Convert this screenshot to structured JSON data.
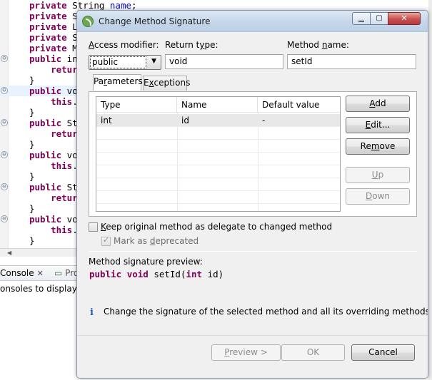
{
  "editor": {
    "lines": [
      {
        "kw": "private",
        "rest": " String ",
        "field": "name",
        "tail": ";",
        "fold": false,
        "highlight": false
      },
      {
        "kw": "private",
        "rest": " S",
        "field": "",
        "tail": "",
        "fold": false,
        "highlight": false
      },
      {
        "kw": "private",
        "rest": " L",
        "field": "",
        "tail": "",
        "fold": false,
        "highlight": false
      },
      {
        "kw": "private",
        "rest": " S",
        "field": "",
        "tail": "",
        "fold": false,
        "highlight": false
      },
      {
        "kw": "private",
        "rest": " M",
        "field": "",
        "tail": "",
        "fold": false,
        "highlight": false
      },
      {
        "kw": "public",
        "rest": " in",
        "field": "",
        "tail": "",
        "fold": true,
        "highlight": false
      },
      {
        "kw": "    return",
        "rest": "",
        "field": "",
        "tail": "",
        "fold": false,
        "highlight": false
      },
      {
        "kw": "",
        "rest": "}",
        "field": "",
        "tail": "",
        "fold": false,
        "highlight": false
      },
      {
        "kw": "public",
        "rest": " voi",
        "field": "",
        "tail": "",
        "fold": true,
        "highlight": true
      },
      {
        "kw": "    this",
        "rest": ".",
        "field": "",
        "tail": "",
        "fold": false,
        "highlight": false
      },
      {
        "kw": "",
        "rest": "}",
        "field": "",
        "tail": "",
        "fold": false,
        "highlight": false
      },
      {
        "kw": "public",
        "rest": " St",
        "field": "",
        "tail": "",
        "fold": true,
        "highlight": false
      },
      {
        "kw": "    return",
        "rest": "",
        "field": "",
        "tail": "",
        "fold": false,
        "highlight": false
      },
      {
        "kw": "",
        "rest": "}",
        "field": "",
        "tail": "",
        "fold": false,
        "highlight": false
      },
      {
        "kw": "public",
        "rest": " voi",
        "field": "",
        "tail": "",
        "fold": true,
        "highlight": false
      },
      {
        "kw": "    this",
        "rest": ".",
        "field": "",
        "tail": "",
        "fold": false,
        "highlight": false
      },
      {
        "kw": "",
        "rest": "}",
        "field": "",
        "tail": "",
        "fold": false,
        "highlight": false
      },
      {
        "kw": "public",
        "rest": " St",
        "field": "",
        "tail": "",
        "fold": true,
        "highlight": false
      },
      {
        "kw": "    return",
        "rest": "",
        "field": "",
        "tail": "",
        "fold": false,
        "highlight": false
      },
      {
        "kw": "",
        "rest": "}",
        "field": "",
        "tail": "",
        "fold": false,
        "highlight": false
      },
      {
        "kw": "public",
        "rest": " voi",
        "field": "",
        "tail": "",
        "fold": true,
        "highlight": false
      },
      {
        "kw": "    this",
        "rest": ".",
        "field": "",
        "tail": "",
        "fold": false,
        "highlight": false
      },
      {
        "kw": "",
        "rest": "}",
        "field": "",
        "tail": "",
        "fold": false,
        "highlight": false
      }
    ]
  },
  "console": {
    "tab_label": "Console",
    "close_glyph": "✕",
    "progress_tab_label": "Pro",
    "message": "onsoles to display at"
  },
  "dialog": {
    "title": "Change Method Signature",
    "window_buttons": {
      "minimize": "▁",
      "maximize": "▢",
      "close": "✕"
    },
    "access_modifier_label_u": "A",
    "access_modifier_label_rest": "ccess modifier:",
    "access_modifier_value": "public",
    "return_type_label_pre": "Return t",
    "return_type_label_u": "y",
    "return_type_label_rest": "pe:",
    "return_type_value": "void",
    "method_name_label_pre": "Method ",
    "method_name_label_u": "n",
    "method_name_label_rest": "ame:",
    "method_name_value": "setId",
    "tabs": [
      {
        "pre": "Pa",
        "u": "r",
        "rest": "ameters"
      },
      {
        "pre": "E",
        "u": "x",
        "rest": "ceptions"
      }
    ],
    "table": {
      "columns": [
        "Type",
        "Name",
        "Default value"
      ],
      "rows": [
        {
          "type": "int",
          "name": "id",
          "default": "-"
        }
      ]
    },
    "side_buttons": [
      {
        "pre": "",
        "u": "A",
        "rest": "dd",
        "enabled": true
      },
      {
        "pre": "",
        "u": "E",
        "rest": "dit...",
        "enabled": true
      },
      {
        "pre": "Re",
        "u": "m",
        "rest": "ove",
        "enabled": true
      },
      {
        "pre": "",
        "u": "U",
        "rest": "p",
        "enabled": false
      },
      {
        "pre": "",
        "u": "D",
        "rest": "own",
        "enabled": false
      }
    ],
    "keep_delegate_pre": "",
    "keep_delegate_u": "K",
    "keep_delegate_rest": "eep original method as delegate to changed method",
    "mark_deprecated_pre": "Mark as ",
    "mark_deprecated_u": "d",
    "mark_deprecated_rest": "eprecated",
    "preview_label": "Method signature preview:",
    "preview_kw1": "public",
    "preview_kw2": "void",
    "preview_mid": " setId(",
    "preview_kw3": "int",
    "preview_tail": " id)",
    "info_icon_glyph": "i",
    "info_text": "Change the signature of the selected method and all its overriding methods.",
    "preview_button_pre": "",
    "preview_button_u": "P",
    "preview_button_rest": "review >",
    "ok_label": "OK",
    "cancel_label": "Cancel"
  }
}
